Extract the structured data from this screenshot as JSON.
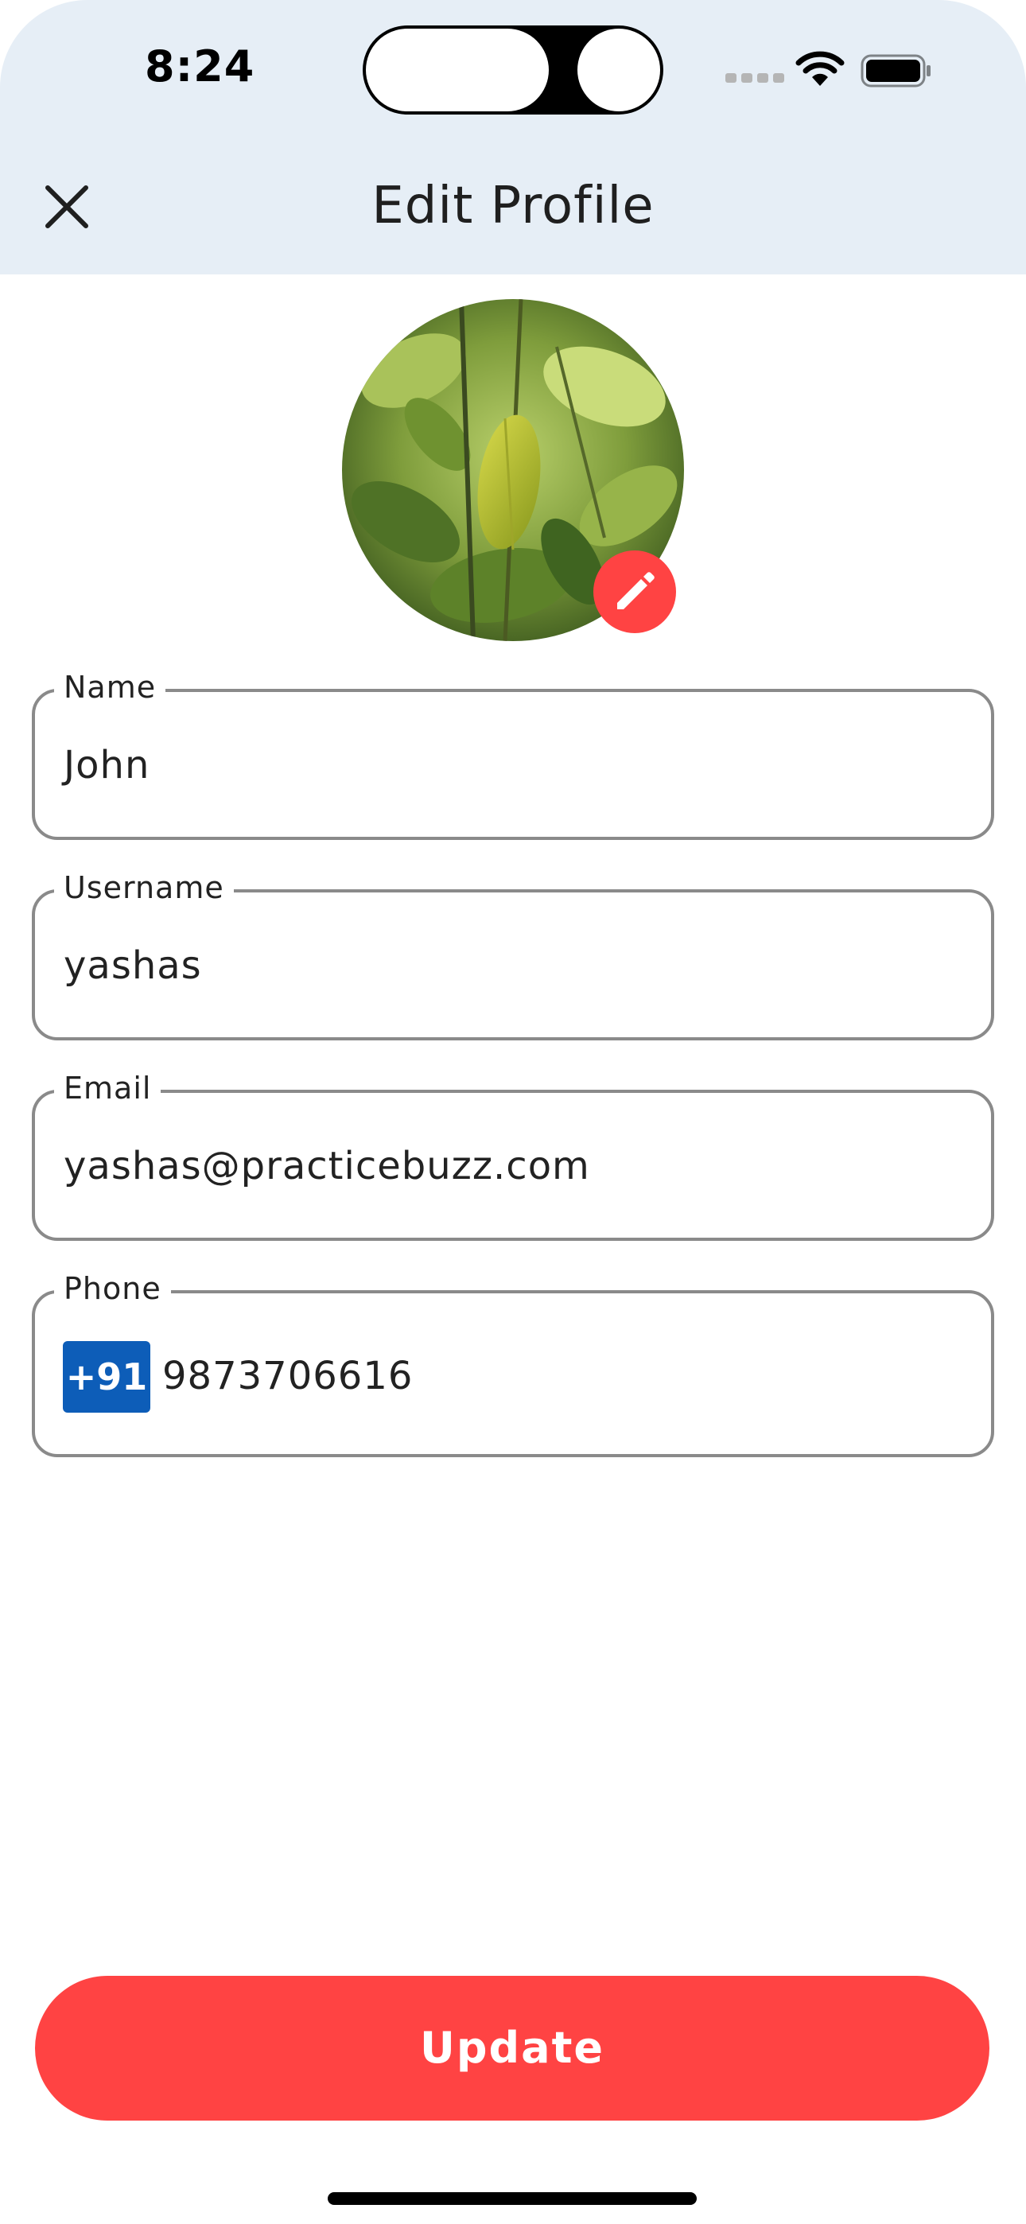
{
  "status_bar": {
    "time": "8:24"
  },
  "app_bar": {
    "title": "Edit Profile",
    "close_icon": "close-icon"
  },
  "profile": {
    "avatar_icon": "edit-pencil-icon"
  },
  "form": {
    "name": {
      "label": "Name",
      "value": "John"
    },
    "username": {
      "label": "Username",
      "value": "yashas"
    },
    "email": {
      "label": "Email",
      "value": "yashas@practicebuzz.com"
    },
    "phone": {
      "label": "Phone",
      "country_code": "+91",
      "value": "9873706616"
    }
  },
  "actions": {
    "update_label": "Update"
  },
  "colors": {
    "accent": "#ff4343",
    "header_bg": "#e6eef6",
    "country_code_bg": "#0d5db8",
    "field_border": "#8a8a8a"
  }
}
